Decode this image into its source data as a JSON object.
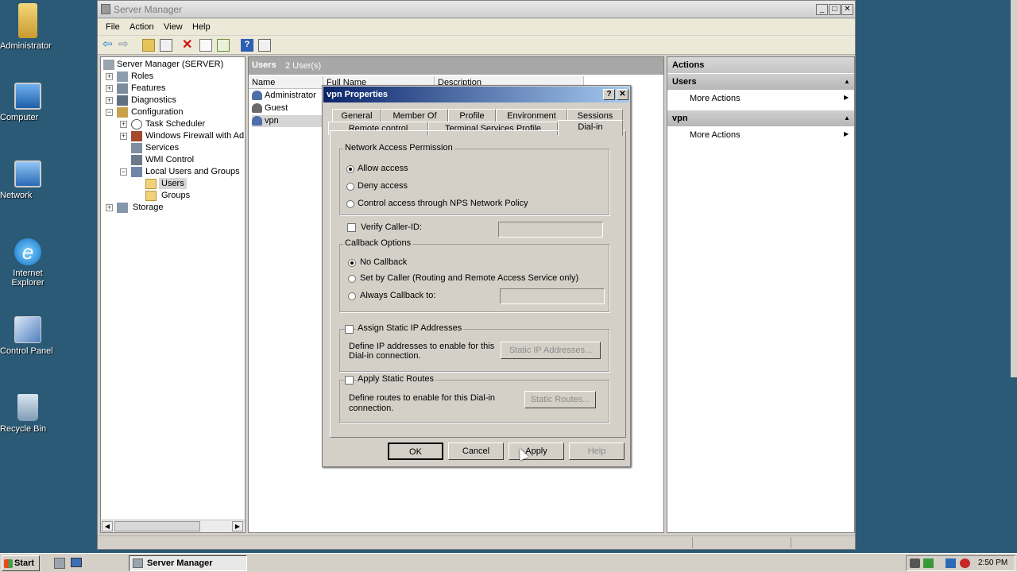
{
  "desktop": {
    "icons": [
      {
        "label": "Administrator",
        "icon": "user-folder-icon"
      },
      {
        "label": "Computer",
        "icon": "computer-icon"
      },
      {
        "label": "Network",
        "icon": "network-icon"
      },
      {
        "label": "Internet Explorer",
        "icon": "internet-explorer-icon"
      },
      {
        "label": "Control Panel",
        "icon": "control-panel-icon"
      },
      {
        "label": "Recycle Bin",
        "icon": "recycle-bin-icon"
      }
    ]
  },
  "window": {
    "title": "Server Manager",
    "menu": [
      "File",
      "Action",
      "View",
      "Help"
    ]
  },
  "tree": {
    "root": "Server Manager (SERVER)",
    "items": [
      "Roles",
      "Features",
      "Diagnostics",
      "Configuration",
      "Task Scheduler",
      "Windows Firewall with Adva",
      "Services",
      "WMI Control",
      "Local Users and Groups",
      "Users",
      "Groups",
      "Storage"
    ]
  },
  "center": {
    "title": "Users",
    "count": "2 User(s)",
    "columns": [
      "Name",
      "Full Name",
      "Description"
    ],
    "rows": [
      "Administrator",
      "Guest",
      "vpn"
    ]
  },
  "actions": {
    "title": "Actions",
    "sections": [
      {
        "name": "Users",
        "item": "More Actions"
      },
      {
        "name": "vpn",
        "item": "More Actions"
      }
    ]
  },
  "dialog": {
    "title": "vpn Properties",
    "help_btn": "?",
    "close_btn": "✕",
    "tabs_row1": [
      "General",
      "Member Of",
      "Profile",
      "Environment",
      "Sessions"
    ],
    "tabs_row2": [
      "Remote control",
      "Terminal Services Profile",
      "Dial-in"
    ],
    "network_access": {
      "label": "Network Access Permission",
      "options": [
        "Allow access",
        "Deny access",
        "Control access through NPS Network Policy"
      ],
      "selected": 0
    },
    "verify_caller": "Verify Caller-ID:",
    "callback": {
      "label": "Callback Options",
      "options": [
        "No Callback",
        "Set by Caller (Routing and Remote Access Service only)",
        "Always Callback to:"
      ],
      "selected": 0
    },
    "static_ip": {
      "label": "Assign Static IP Addresses",
      "desc_line1": "Define IP addresses to enable for this",
      "desc_line2": "Dial-in connection.",
      "button": "Static IP Addresses..."
    },
    "static_routes": {
      "label": "Apply Static Routes",
      "desc_line1": "Define routes to enable for this Dial-in",
      "desc_line2": "connection.",
      "button": "Static Routes..."
    },
    "buttons": {
      "ok": "OK",
      "cancel": "Cancel",
      "apply": "Apply",
      "help": "Help"
    }
  },
  "taskbar": {
    "start": "Start",
    "task": "Server Manager",
    "clock": "2:50 PM"
  }
}
